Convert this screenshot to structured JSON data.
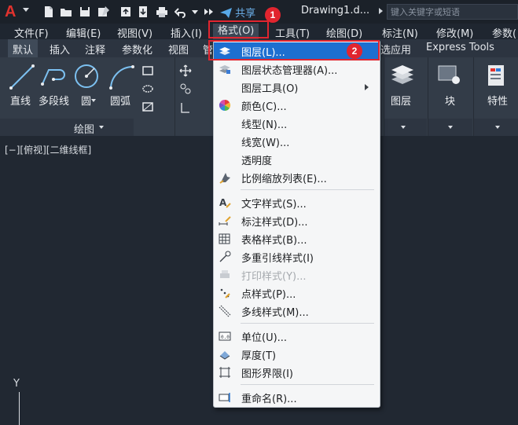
{
  "titlebar": {
    "app_logo": "A",
    "share_label": "共享",
    "document_title": "Drawing1.d...",
    "search_placeholder": "键入关键字或短语"
  },
  "menubar": {
    "items": [
      "文件(F)",
      "编辑(E)",
      "视图(V)",
      "插入(I)",
      "格式(O)",
      "工具(T)",
      "绘图(D)",
      "标注(N)",
      "修改(M)",
      "参数("
    ]
  },
  "ribbon_tabs": {
    "items": [
      "默认",
      "插入",
      "注释",
      "参数化",
      "视图",
      "管",
      "选应用",
      "Express Tools"
    ]
  },
  "ribbon": {
    "tools": [
      "直线",
      "多段线",
      "圆",
      "圆弧"
    ],
    "draw_panel_title": "绘图",
    "layers_label": "图层",
    "block_label": "块",
    "properties_label": "特性"
  },
  "canvas": {
    "viewport_label": "[−][俯视][二维线框]",
    "ucs_y": "Y"
  },
  "dropdown": {
    "items": [
      {
        "label": "图层(L)...",
        "icon": "layer-icon",
        "highlighted": true
      },
      {
        "label": "图层状态管理器(A)...",
        "icon": "layer-state-icon"
      },
      {
        "label": "图层工具(O)",
        "icon": "none",
        "submenu": true
      },
      {
        "label": "颜色(C)...",
        "icon": "color-wheel-icon"
      },
      {
        "label": "线型(N)...",
        "icon": "none"
      },
      {
        "label": "线宽(W)...",
        "icon": "none"
      },
      {
        "label": "透明度",
        "icon": "none"
      },
      {
        "label": "比例缩放列表(E)...",
        "icon": "scale-list-icon"
      },
      {
        "label": "文字样式(S)...",
        "icon": "text-style-icon"
      },
      {
        "label": "标注样式(D)...",
        "icon": "dimension-style-icon"
      },
      {
        "label": "表格样式(B)...",
        "icon": "table-style-icon"
      },
      {
        "label": "多重引线样式(I)",
        "icon": "multileader-style-icon"
      },
      {
        "label": "打印样式(Y)...",
        "icon": "plot-style-icon",
        "disabled": true
      },
      {
        "label": "点样式(P)...",
        "icon": "point-style-icon"
      },
      {
        "label": "多线样式(M)...",
        "icon": "multiline-style-icon"
      },
      {
        "label": "单位(U)...",
        "icon": "units-icon"
      },
      {
        "label": "厚度(T)",
        "icon": "thickness-icon"
      },
      {
        "label": "图形界限(I)",
        "icon": "drawing-limits-icon"
      },
      {
        "label": "重命名(R)...",
        "icon": "rename-icon"
      }
    ]
  },
  "annotations": {
    "step1": "1",
    "step2": "2",
    "color": "#e1252f"
  },
  "colors": {
    "highlight": "#1d6fd0",
    "accent_red": "#e0322e"
  }
}
